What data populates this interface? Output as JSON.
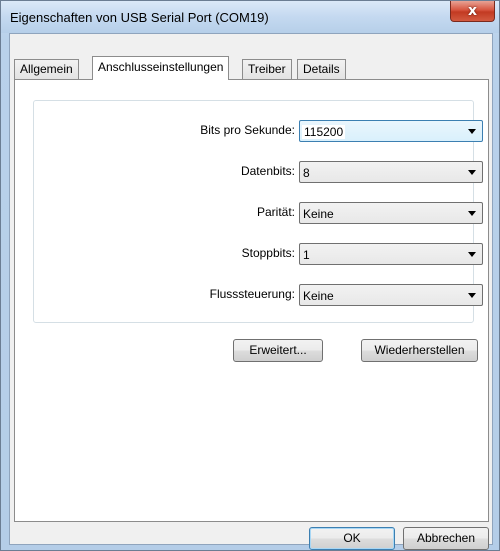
{
  "window": {
    "title": "Eigenschaften von USB Serial Port (COM19)",
    "close_glyph": "x"
  },
  "tabs": [
    {
      "label": "Allgemein",
      "active": false
    },
    {
      "label": "Anschlusseinstellungen",
      "active": true
    },
    {
      "label": "Treiber",
      "active": false
    },
    {
      "label": "Details",
      "active": false
    }
  ],
  "settings": [
    {
      "label": "Bits pro Sekunde:",
      "value": "115200"
    },
    {
      "label": "Datenbits:",
      "value": "8"
    },
    {
      "label": "Parität:",
      "value": "Keine"
    },
    {
      "label": "Stoppbits:",
      "value": "1"
    },
    {
      "label": "Flusssteuerung:",
      "value": "Keine"
    }
  ],
  "actions": {
    "advanced": "Erweitert...",
    "restore": "Wiederherstellen"
  },
  "footer": {
    "ok": "OK",
    "cancel": "Abbrechen"
  }
}
